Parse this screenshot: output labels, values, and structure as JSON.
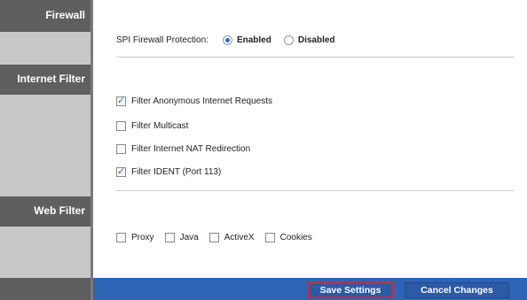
{
  "sidebar": {
    "sections": [
      "Firewall",
      "Internet Filter",
      "Web Filter"
    ]
  },
  "firewall": {
    "spi_label": "SPI Firewall Protection:",
    "enabled_label": "Enabled",
    "disabled_label": "Disabled",
    "selected": "Enabled"
  },
  "internet_filter": {
    "options": [
      {
        "label": "Filter Anonymous Internet Requests",
        "checked": true
      },
      {
        "label": "Filter Multicast",
        "checked": false
      },
      {
        "label": "Filter Internet NAT Redirection",
        "checked": false
      },
      {
        "label": "Filter IDENT (Port 113)",
        "checked": true
      }
    ]
  },
  "web_filter": {
    "options": [
      {
        "label": "Proxy",
        "checked": false
      },
      {
        "label": "Java",
        "checked": false
      },
      {
        "label": "ActiveX",
        "checked": false
      },
      {
        "label": "Cookies",
        "checked": false
      }
    ]
  },
  "footer": {
    "save_label": "Save Settings",
    "cancel_label": "Cancel Changes"
  },
  "colors": {
    "sidebar_header": "#5f5f5f",
    "sidebar_bg": "#c8c8c8",
    "footer_bar": "#2f63b4",
    "save_highlight": "#d4262c"
  }
}
